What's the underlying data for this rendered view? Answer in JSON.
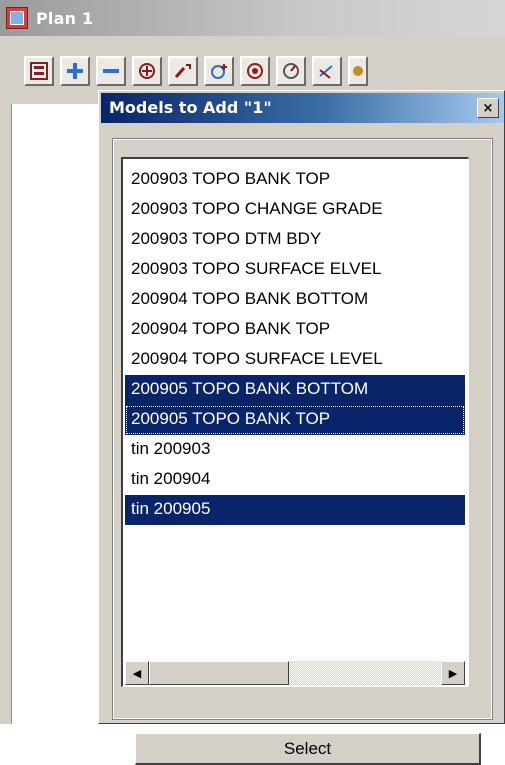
{
  "window": {
    "title": "Plan 1"
  },
  "toolbar": {
    "buttons": [
      {
        "icon": "layers-icon"
      },
      {
        "icon": "add-icon"
      },
      {
        "icon": "remove-icon"
      },
      {
        "icon": "zoom-in-icon"
      },
      {
        "icon": "pan-icon"
      },
      {
        "icon": "zoom-extents-icon"
      },
      {
        "icon": "target-icon"
      },
      {
        "icon": "rotate-icon"
      },
      {
        "icon": "edit-icon"
      },
      {
        "icon": "settings-icon"
      }
    ]
  },
  "dialog": {
    "title": "Models to Add \"1\"",
    "close_label": "×",
    "select_label": "Select",
    "items": [
      {
        "label": "200903 TOPO BANK TOP",
        "selected": false
      },
      {
        "label": "200903 TOPO CHANGE GRADE",
        "selected": false
      },
      {
        "label": "200903 TOPO DTM BDY",
        "selected": false
      },
      {
        "label": "200903 TOPO SURFACE ELVEL",
        "selected": false
      },
      {
        "label": "200904 TOPO BANK BOTTOM",
        "selected": false
      },
      {
        "label": "200904 TOPO BANK TOP",
        "selected": false
      },
      {
        "label": "200904 TOPO SURFACE LEVEL",
        "selected": false
      },
      {
        "label": "200905 TOPO BANK BOTTOM",
        "selected": true
      },
      {
        "label": "200905 TOPO BANK TOP",
        "selected": true,
        "focused": true
      },
      {
        "label": "tin 200903",
        "selected": false
      },
      {
        "label": "tin 200904",
        "selected": false
      },
      {
        "label": "tin 200905",
        "selected": true
      }
    ],
    "scroll_left_icon": "scroll-left-arrow-icon",
    "scroll_right_icon": "scroll-right-arrow-icon"
  },
  "colors": {
    "selection": "#0a246a",
    "dialog_title_start": "#0a246a",
    "window_face": "#d4d0c8"
  }
}
